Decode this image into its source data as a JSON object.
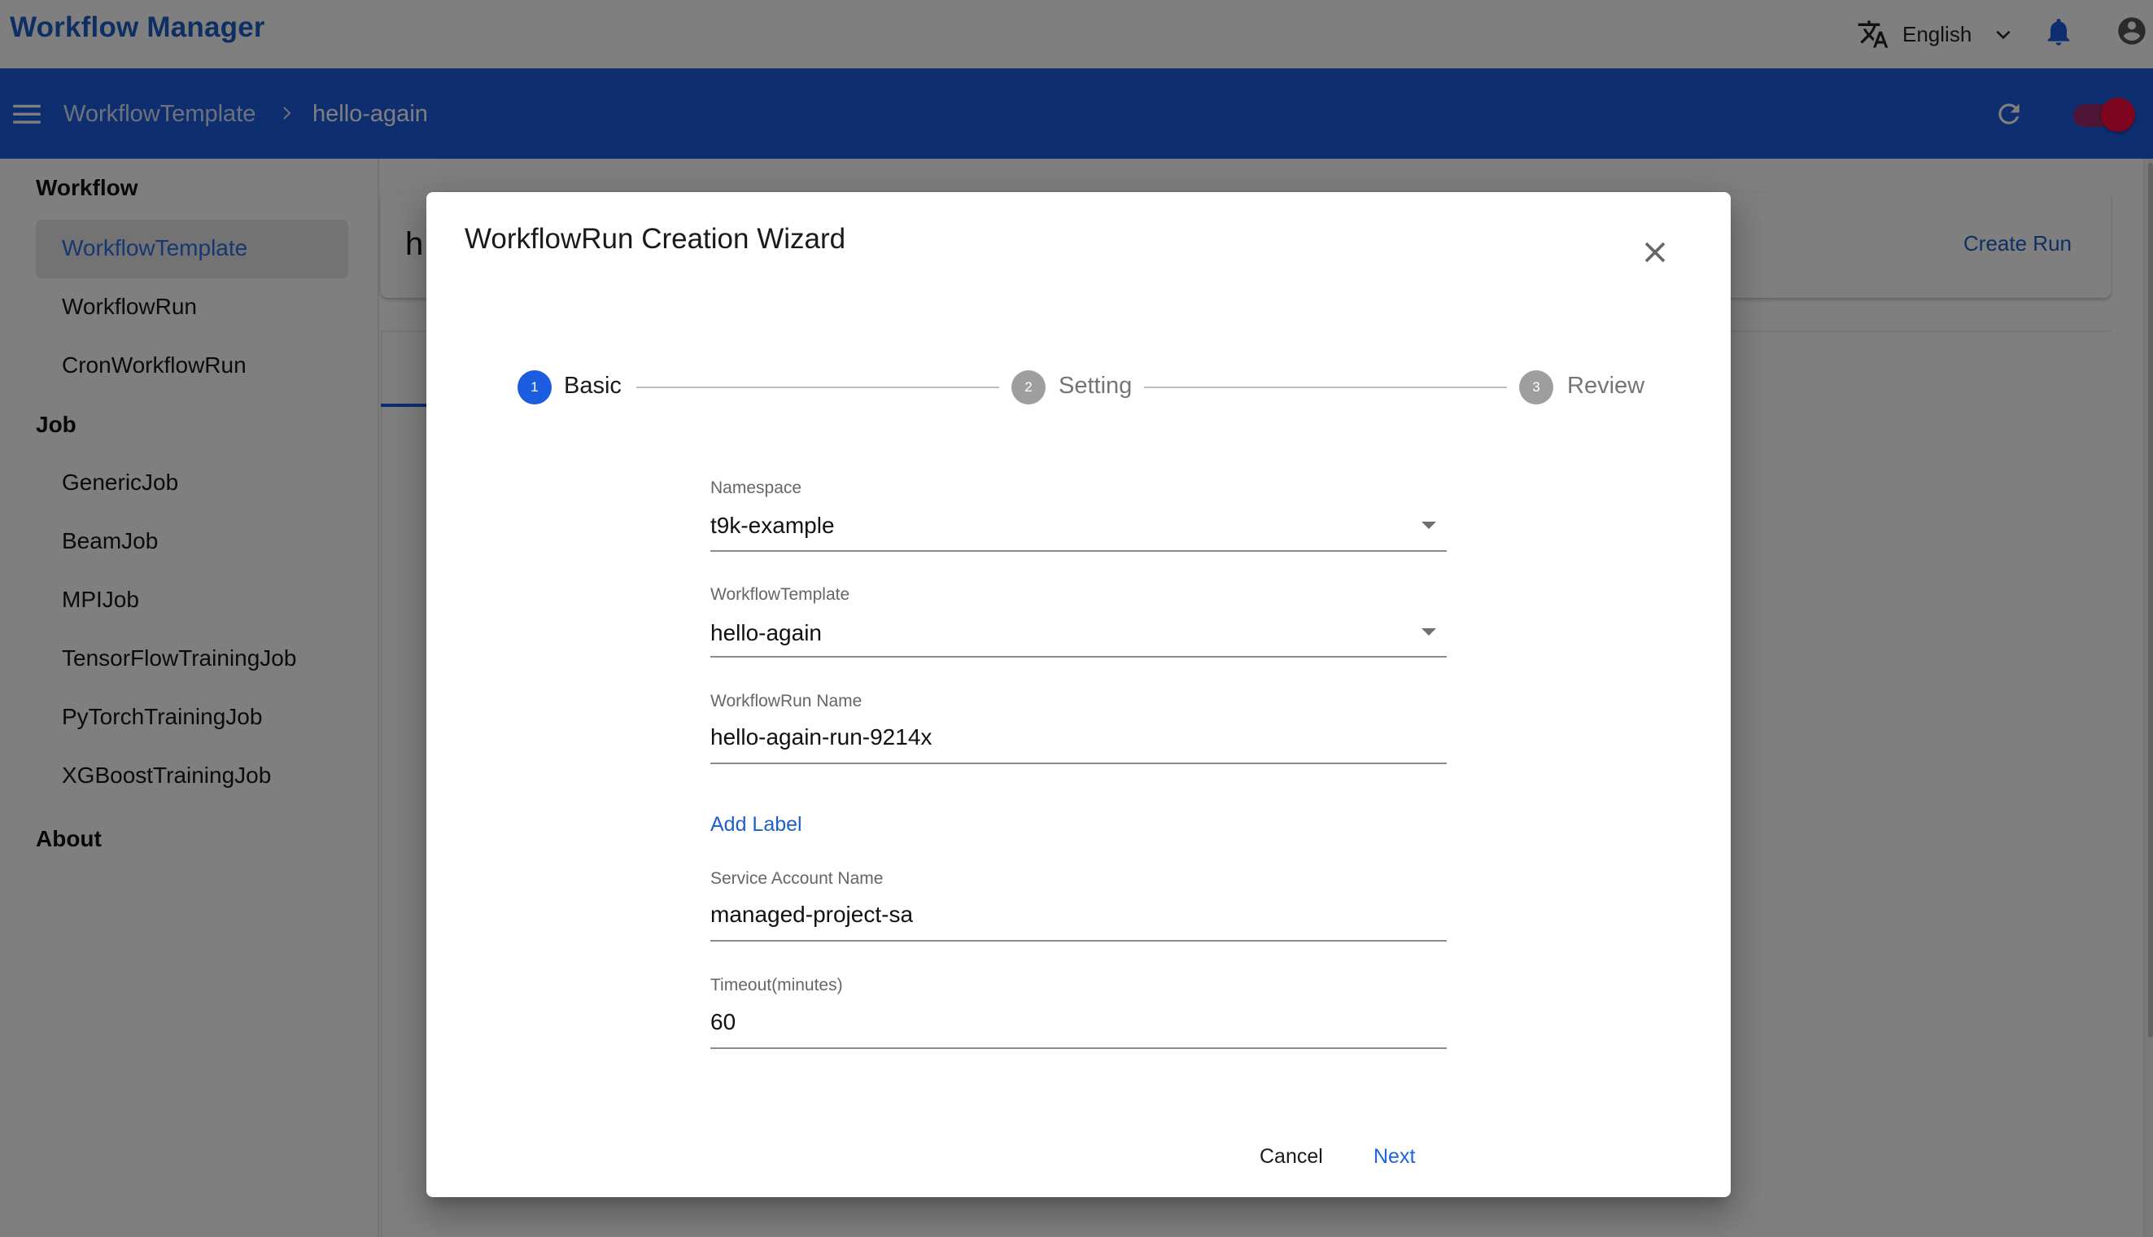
{
  "app": {
    "title": "Workflow Manager",
    "language": "English",
    "language_icon": "translate-icon",
    "notifications_icon": "bell-icon",
    "account_icon": "account-circle-icon"
  },
  "appbar": {
    "menu_icon": "hamburger-menu-icon",
    "breadcrumb": [
      "WorkflowTemplate",
      "hello-again"
    ],
    "refresh_icon": "refresh-icon",
    "toggle_on": true
  },
  "sidebar": {
    "sections": [
      {
        "heading": "Workflow",
        "items": [
          {
            "label": "WorkflowTemplate",
            "active": true
          },
          {
            "label": "WorkflowRun",
            "active": false
          },
          {
            "label": "CronWorkflowRun",
            "active": false
          }
        ]
      },
      {
        "heading": "Job",
        "items": [
          {
            "label": "GenericJob",
            "active": false
          },
          {
            "label": "BeamJob",
            "active": false
          },
          {
            "label": "MPIJob",
            "active": false
          },
          {
            "label": "TensorFlowTrainingJob",
            "active": false
          },
          {
            "label": "PyTorchTrainingJob",
            "active": false
          },
          {
            "label": "XGBoostTrainingJob",
            "active": false
          }
        ]
      },
      {
        "heading": "About",
        "items": []
      }
    ]
  },
  "main": {
    "title_peek": "h",
    "create_run_label": "Create Run"
  },
  "dialog": {
    "title": "WorkflowRun Creation Wizard",
    "close_icon": "close-icon",
    "steps": [
      {
        "number": "1",
        "label": "Basic",
        "active": true
      },
      {
        "number": "2",
        "label": "Setting",
        "active": false
      },
      {
        "number": "3",
        "label": "Review",
        "active": false
      }
    ],
    "fields": {
      "namespace": {
        "label": "Namespace",
        "value": "t9k-example"
      },
      "workflow_template": {
        "label": "WorkflowTemplate",
        "value": "hello-again"
      },
      "workflowrun_name": {
        "label": "WorkflowRun Name",
        "value": "hello-again-run-9214x"
      },
      "service_account": {
        "label": "Service Account Name",
        "value": "managed-project-sa"
      },
      "timeout": {
        "label": "Timeout(minutes)",
        "value": "60"
      }
    },
    "add_label": "Add Label",
    "cancel_label": "Cancel",
    "next_label": "Next"
  },
  "colors": {
    "primary": "#1c5de0",
    "step_active": "#1c5de0",
    "step_inactive": "#9e9e9e",
    "toggle": "#ff0a3f"
  }
}
